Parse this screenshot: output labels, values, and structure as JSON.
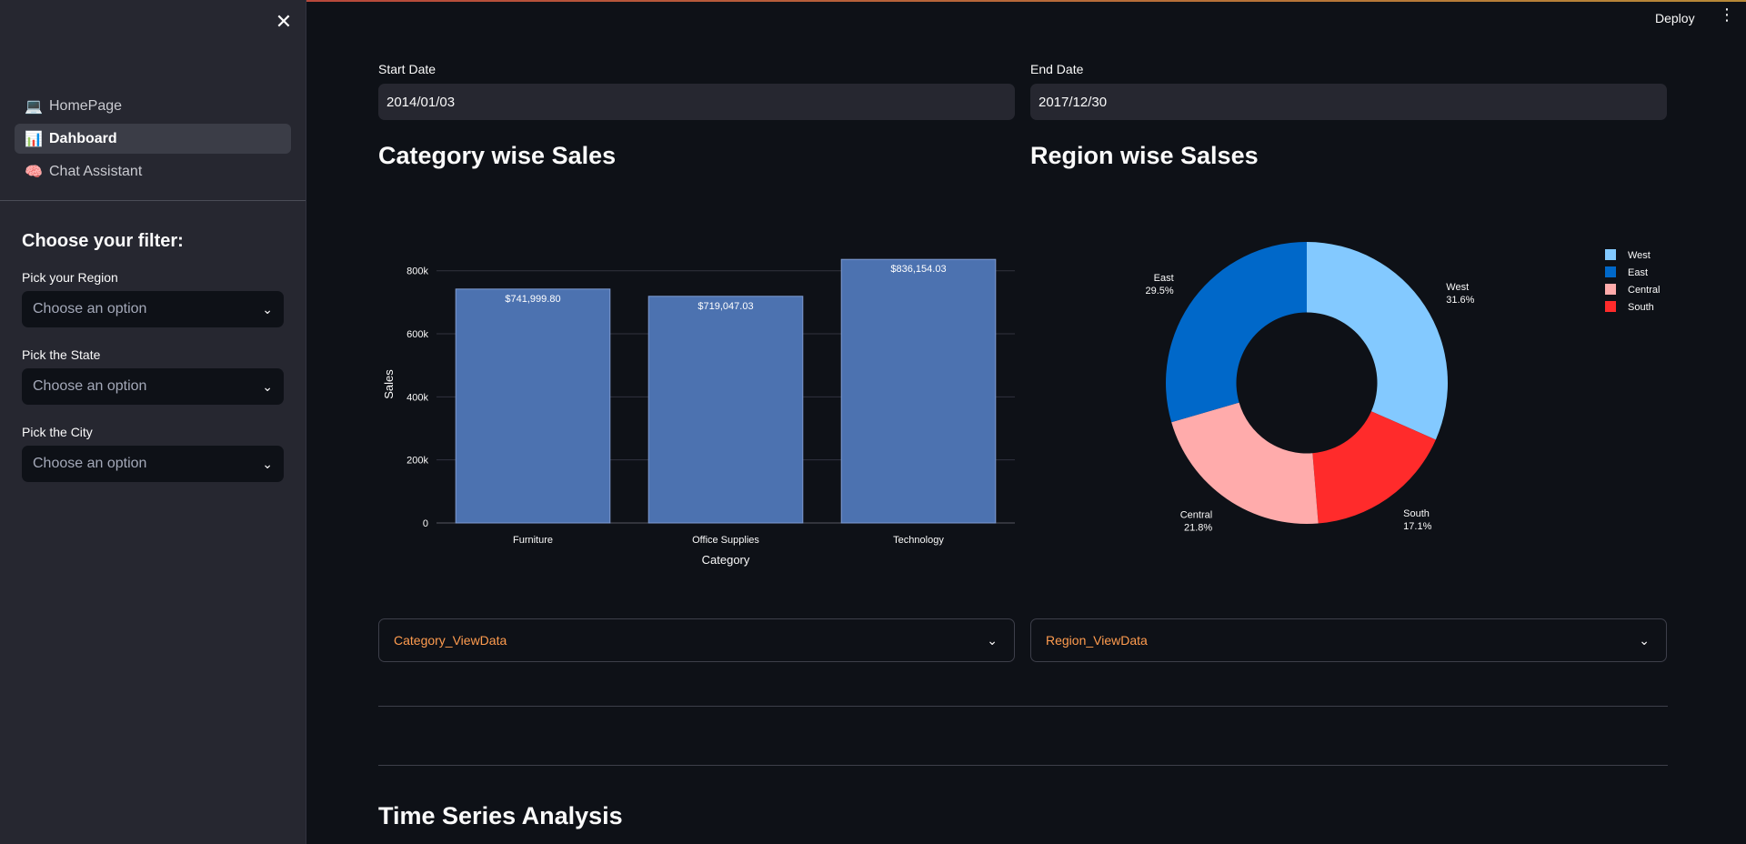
{
  "header": {
    "deploy_label": "Deploy"
  },
  "sidebar": {
    "nav": [
      {
        "label": "HomePage",
        "emoji": "💻",
        "active": false
      },
      {
        "label": "Dahboard",
        "emoji": "📊",
        "active": true
      },
      {
        "label": "Chat Assistant",
        "emoji": "🧠",
        "active": false
      }
    ],
    "filter_title": "Choose your filter:",
    "filters": [
      {
        "label": "Pick your Region",
        "placeholder": "Choose an option"
      },
      {
        "label": "Pick the State",
        "placeholder": "Choose an option"
      },
      {
        "label": "Pick the City",
        "placeholder": "Choose an option"
      }
    ]
  },
  "main": {
    "start_date_label": "Start Date",
    "start_date_value": "2014/01/03",
    "end_date_label": "End Date",
    "end_date_value": "2017/12/30",
    "category_title": "Category wise Sales",
    "region_title": "Region wise Salses",
    "category_expander": "Category_ViewData",
    "region_expander": "Region_ViewData",
    "time_series_title": "Time Series Analysis"
  },
  "chart_data": [
    {
      "type": "bar",
      "categories": [
        "Furniture",
        "Office Supplies",
        "Technology"
      ],
      "values": [
        741999.8,
        719047.03,
        836154.03
      ],
      "data_labels": [
        "$741,999.80",
        "$719,047.03",
        "$836,154.03"
      ],
      "xlabel": "Category",
      "ylabel": "Sales",
      "yticks": [
        0,
        200000,
        400000,
        600000,
        800000
      ],
      "ytick_labels": [
        "0",
        "200k",
        "400k",
        "600k",
        "800k"
      ],
      "ylim": [
        0,
        880000
      ],
      "bar_color": "#4c72b0",
      "grid": true
    },
    {
      "type": "pie",
      "hole": 0.5,
      "categories": [
        "West",
        "South",
        "Central",
        "East"
      ],
      "values": [
        31.6,
        17.1,
        21.8,
        29.5
      ],
      "labels": [
        "31.6%",
        "17.1%",
        "21.8%",
        "29.5%"
      ],
      "colors": [
        "#83c9ff",
        "#ff2b2b",
        "#ffabab",
        "#0068c9"
      ],
      "legend": [
        "West",
        "East",
        "Central",
        "South"
      ],
      "legend_colors": [
        "#83c9ff",
        "#0068c9",
        "#ffabab",
        "#ff2b2b"
      ],
      "legend_position": "top-right"
    }
  ]
}
